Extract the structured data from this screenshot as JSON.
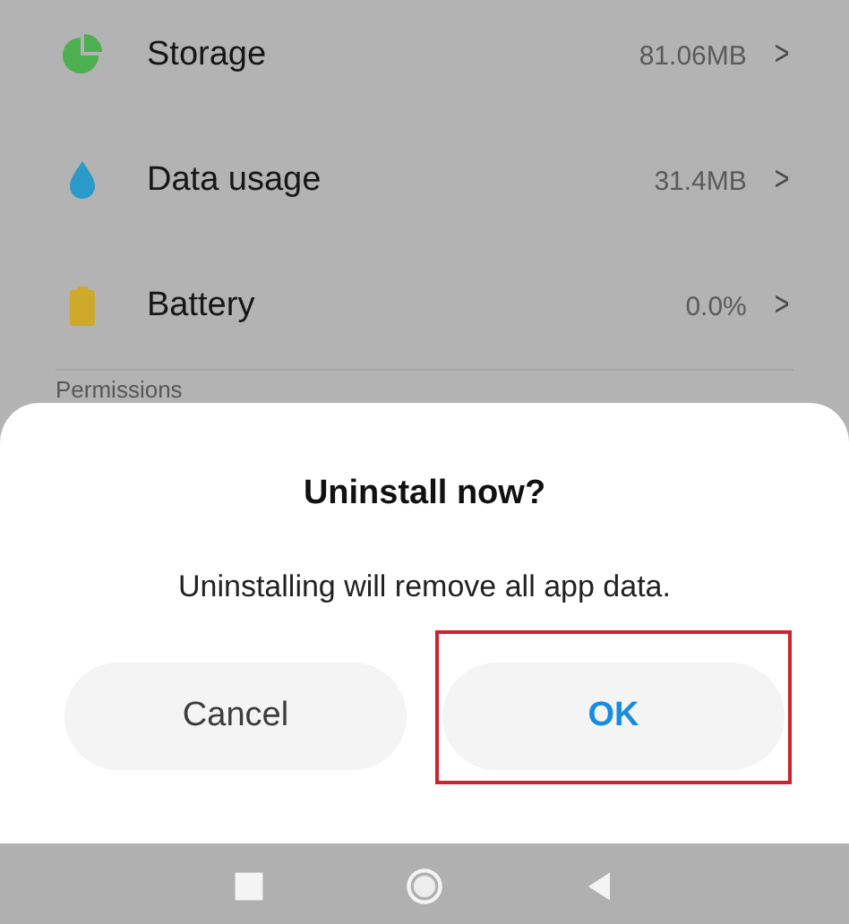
{
  "settings_rows": [
    {
      "kind": "storage",
      "label": "Storage",
      "value": "81.06MB",
      "chevron": ">"
    },
    {
      "kind": "data",
      "label": "Data usage",
      "value": "31.4MB",
      "chevron": ">"
    },
    {
      "kind": "battery",
      "label": "Battery",
      "value": "0.0%",
      "chevron": ">"
    }
  ],
  "section_header": "Permissions",
  "dialog": {
    "title": "Uninstall now?",
    "message": "Uninstalling will remove all app data.",
    "buttons": [
      {
        "label": "Cancel",
        "kind": "neutral",
        "highlighted": false
      },
      {
        "label": "OK",
        "kind": "primary",
        "highlighted": true
      }
    ]
  },
  "nav_bar": [
    {
      "kind": "recents"
    },
    {
      "kind": "home"
    },
    {
      "kind": "back"
    }
  ]
}
